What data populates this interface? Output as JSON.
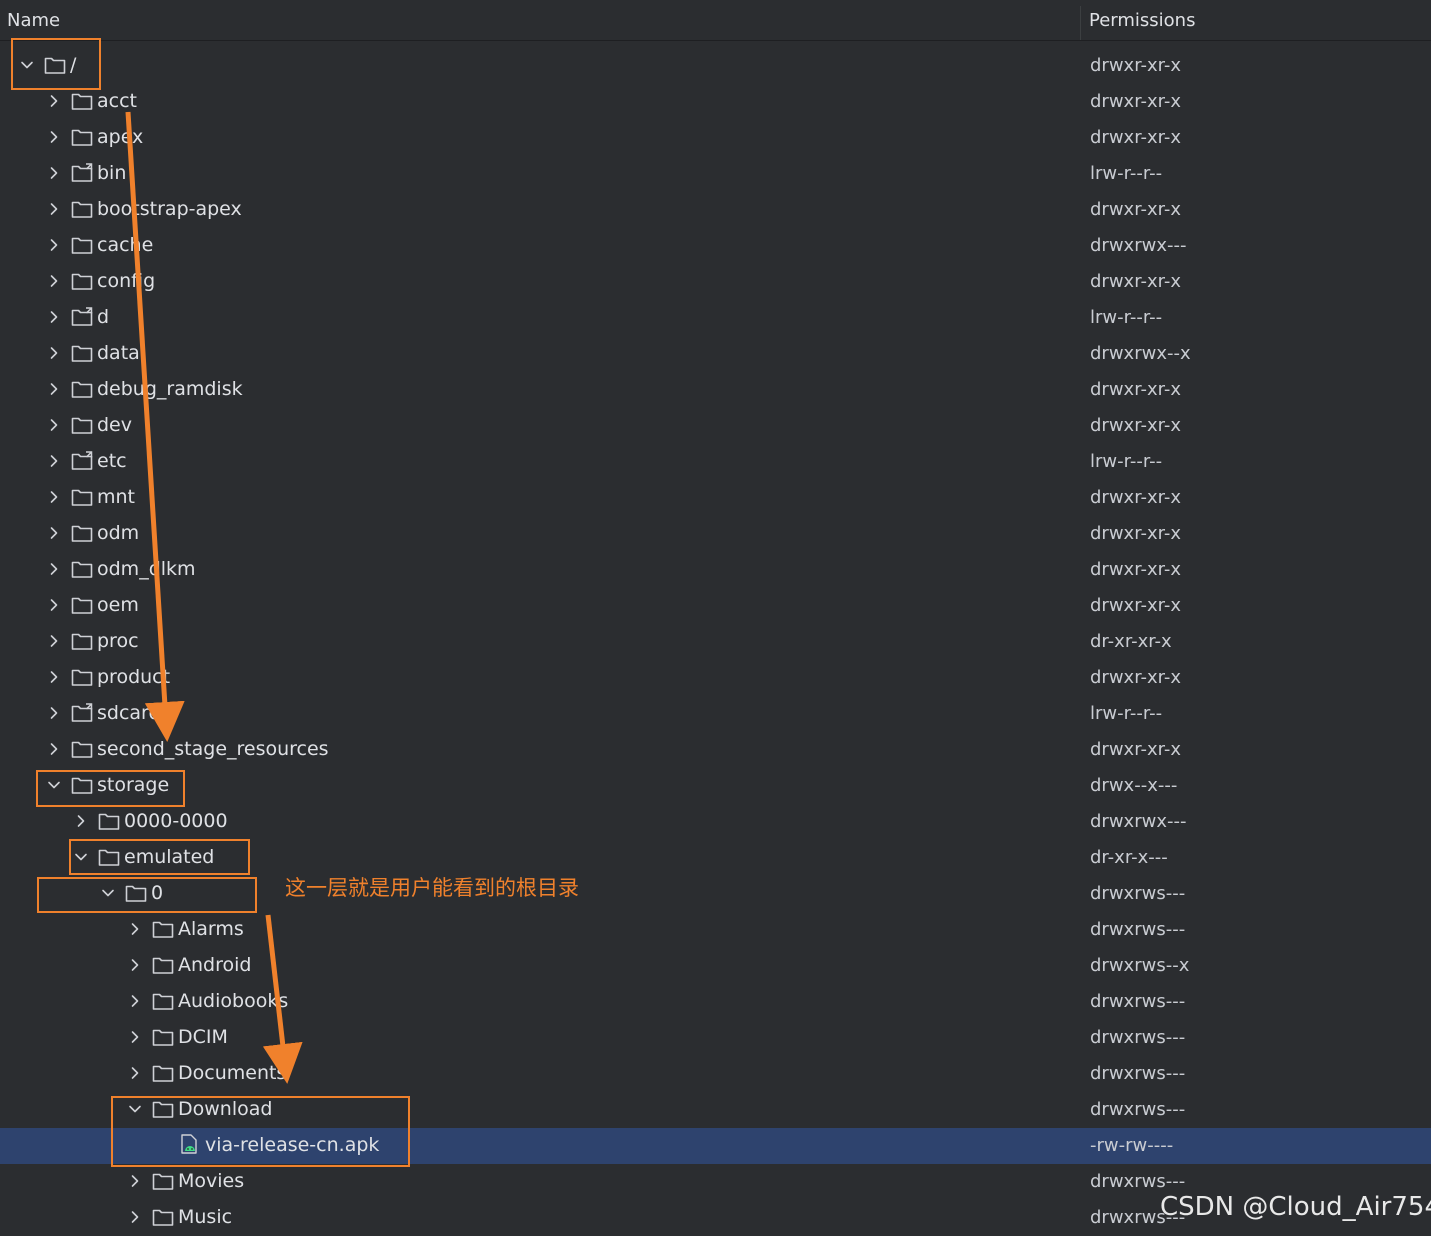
{
  "header": {
    "name_label": "Name",
    "permissions_label": "Permissions"
  },
  "rows": [
    {
      "label": "/",
      "perm": "drwxr-xr-x",
      "level": 0,
      "expanded": true,
      "icon": "folder-icon"
    },
    {
      "label": "acct",
      "perm": "drwxr-xr-x",
      "level": 1,
      "expanded": false,
      "icon": "folder-icon"
    },
    {
      "label": "apex",
      "perm": "drwxr-xr-x",
      "level": 1,
      "expanded": false,
      "icon": "folder-icon"
    },
    {
      "label": "bin",
      "perm": "lrw-r--r--",
      "level": 1,
      "expanded": false,
      "icon": "folder-link-icon"
    },
    {
      "label": "bootstrap-apex",
      "perm": "drwxr-xr-x",
      "level": 1,
      "expanded": false,
      "icon": "folder-icon"
    },
    {
      "label": "cache",
      "perm": "drwxrwx---",
      "level": 1,
      "expanded": false,
      "icon": "folder-icon"
    },
    {
      "label": "config",
      "perm": "drwxr-xr-x",
      "level": 1,
      "expanded": false,
      "icon": "folder-icon"
    },
    {
      "label": "d",
      "perm": "lrw-r--r--",
      "level": 1,
      "expanded": false,
      "icon": "folder-link-icon"
    },
    {
      "label": "data",
      "perm": "drwxrwx--x",
      "level": 1,
      "expanded": false,
      "icon": "folder-icon"
    },
    {
      "label": "debug_ramdisk",
      "perm": "drwxr-xr-x",
      "level": 1,
      "expanded": false,
      "icon": "folder-icon"
    },
    {
      "label": "dev",
      "perm": "drwxr-xr-x",
      "level": 1,
      "expanded": false,
      "icon": "folder-icon"
    },
    {
      "label": "etc",
      "perm": "lrw-r--r--",
      "level": 1,
      "expanded": false,
      "icon": "folder-link-icon"
    },
    {
      "label": "mnt",
      "perm": "drwxr-xr-x",
      "level": 1,
      "expanded": false,
      "icon": "folder-icon"
    },
    {
      "label": "odm",
      "perm": "drwxr-xr-x",
      "level": 1,
      "expanded": false,
      "icon": "folder-icon"
    },
    {
      "label": "odm_dlkm",
      "perm": "drwxr-xr-x",
      "level": 1,
      "expanded": false,
      "icon": "folder-icon"
    },
    {
      "label": "oem",
      "perm": "drwxr-xr-x",
      "level": 1,
      "expanded": false,
      "icon": "folder-icon"
    },
    {
      "label": "proc",
      "perm": "dr-xr-xr-x",
      "level": 1,
      "expanded": false,
      "icon": "folder-icon"
    },
    {
      "label": "product",
      "perm": "drwxr-xr-x",
      "level": 1,
      "expanded": false,
      "icon": "folder-icon"
    },
    {
      "label": "sdcard",
      "perm": "lrw-r--r--",
      "level": 1,
      "expanded": false,
      "icon": "folder-link-icon"
    },
    {
      "label": "second_stage_resources",
      "perm": "drwxr-xr-x",
      "level": 1,
      "expanded": false,
      "icon": "folder-icon"
    },
    {
      "label": "storage",
      "perm": "drwx--x---",
      "level": 1,
      "expanded": true,
      "icon": "folder-icon"
    },
    {
      "label": "0000-0000",
      "perm": "drwxrwx---",
      "level": 2,
      "expanded": false,
      "icon": "folder-icon"
    },
    {
      "label": "emulated",
      "perm": "dr-xr-x---",
      "level": 2,
      "expanded": true,
      "icon": "folder-icon"
    },
    {
      "label": "0",
      "perm": "drwxrws---",
      "level": 3,
      "expanded": true,
      "icon": "folder-icon"
    },
    {
      "label": "Alarms",
      "perm": "drwxrws---",
      "level": 4,
      "expanded": false,
      "icon": "folder-icon"
    },
    {
      "label": "Android",
      "perm": "drwxrws--x",
      "level": 4,
      "expanded": false,
      "icon": "folder-icon"
    },
    {
      "label": "Audiobooks",
      "perm": "drwxrws---",
      "level": 4,
      "expanded": false,
      "icon": "folder-icon"
    },
    {
      "label": "DCIM",
      "perm": "drwxrws---",
      "level": 4,
      "expanded": false,
      "icon": "folder-icon"
    },
    {
      "label": "Documents",
      "perm": "drwxrws---",
      "level": 4,
      "expanded": false,
      "icon": "folder-icon"
    },
    {
      "label": "Download",
      "perm": "drwxrws---",
      "level": 4,
      "expanded": true,
      "icon": "folder-icon"
    },
    {
      "label": "via-release-cn.apk",
      "perm": "-rw-rw----",
      "level": 5,
      "expanded": null,
      "icon": "android-apk-file-icon",
      "selected": true
    },
    {
      "label": "Movies",
      "perm": "drwxrws---",
      "level": 4,
      "expanded": false,
      "icon": "folder-icon"
    },
    {
      "label": "Music",
      "perm": "drwxrws---",
      "level": 4,
      "expanded": false,
      "icon": "folder-icon"
    }
  ],
  "annotation": {
    "note": "这一层就是用户能看到的根目录",
    "color": "#f0812c"
  },
  "watermark": "CSDN @Cloud_Air754",
  "colors": {
    "background": "#2b2d30",
    "selected_row": "#2e436e",
    "annotation": "#f0812c"
  }
}
